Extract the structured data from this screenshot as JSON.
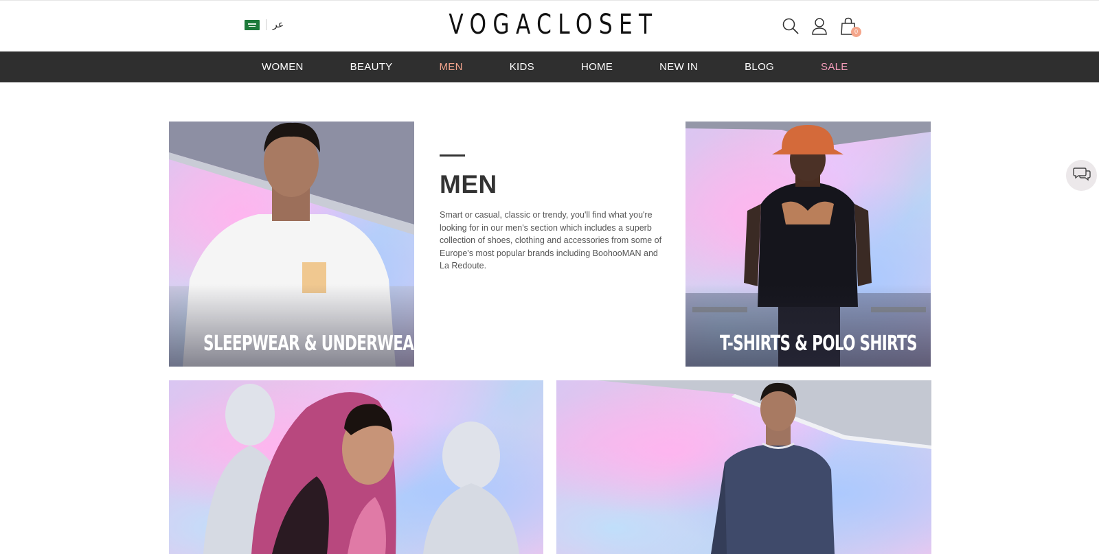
{
  "header": {
    "logo": "VOGACLOSET",
    "language_label": "عر",
    "flag_icon": "saudi-flag-icon",
    "icons": [
      "search-icon",
      "user-icon",
      "cart-icon"
    ],
    "cart_count": "0"
  },
  "nav": {
    "items": [
      {
        "label": "WOMEN"
      },
      {
        "label": "BEAUTY"
      },
      {
        "label": "MEN"
      },
      {
        "label": "KIDS"
      },
      {
        "label": "HOME"
      },
      {
        "label": "NEW IN"
      },
      {
        "label": "BLOG"
      },
      {
        "label": "SALE"
      }
    ],
    "active": "MEN",
    "colors": {
      "bar": "#2f2f2f",
      "active": "#f2a48c",
      "sale": "#f29bb9"
    }
  },
  "intro": {
    "title": "MEN",
    "text": "Smart or casual, classic or trendy, you'll find what you're looking for in our men's section which includes a superb collection of shoes, clothing and accessories from some of Europe's most popular brands including BoohooMAN and La Redoute."
  },
  "tiles": [
    {
      "label": "SLEEPWEAR & UNDERWEAR"
    },
    {
      "label": "T-SHIRTS & POLO SHIRTS"
    },
    {
      "label": ""
    },
    {
      "label": ""
    }
  ],
  "chat": {
    "icon": "chat-icon"
  }
}
